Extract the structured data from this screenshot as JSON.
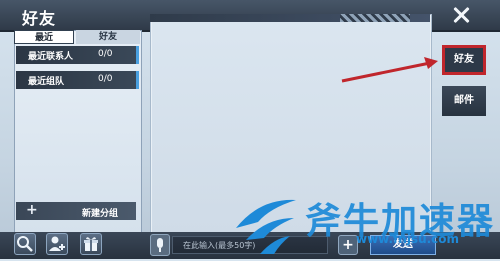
{
  "header": {
    "title": "好友"
  },
  "left_panel": {
    "tabs": [
      {
        "label": "最近"
      },
      {
        "label": "好友"
      }
    ],
    "groups": [
      {
        "name": "最近联系人",
        "count": "0/0"
      },
      {
        "name": "最近组队",
        "count": "0/0"
      }
    ],
    "new_group_label": "新建分组"
  },
  "side_tabs": [
    {
      "label": "好友"
    },
    {
      "label": "邮件"
    }
  ],
  "bottom_bar": {
    "input_placeholder": "在此输入(最多50字)",
    "send_label": "发送"
  },
  "watermark": {
    "text": "斧牛加速器",
    "url": "www.fnjsu.com"
  },
  "colors": {
    "highlight": "#c0262c",
    "send_button": "#2a5fa8",
    "dark_bar": "#2f3a48",
    "watermark": "#1e8ad8"
  },
  "icons": {
    "search": "search-icon",
    "add_friend": "add-friend-icon",
    "gift": "gift-icon",
    "mic": "mic-icon",
    "plus": "plus-icon",
    "close": "close-icon"
  }
}
